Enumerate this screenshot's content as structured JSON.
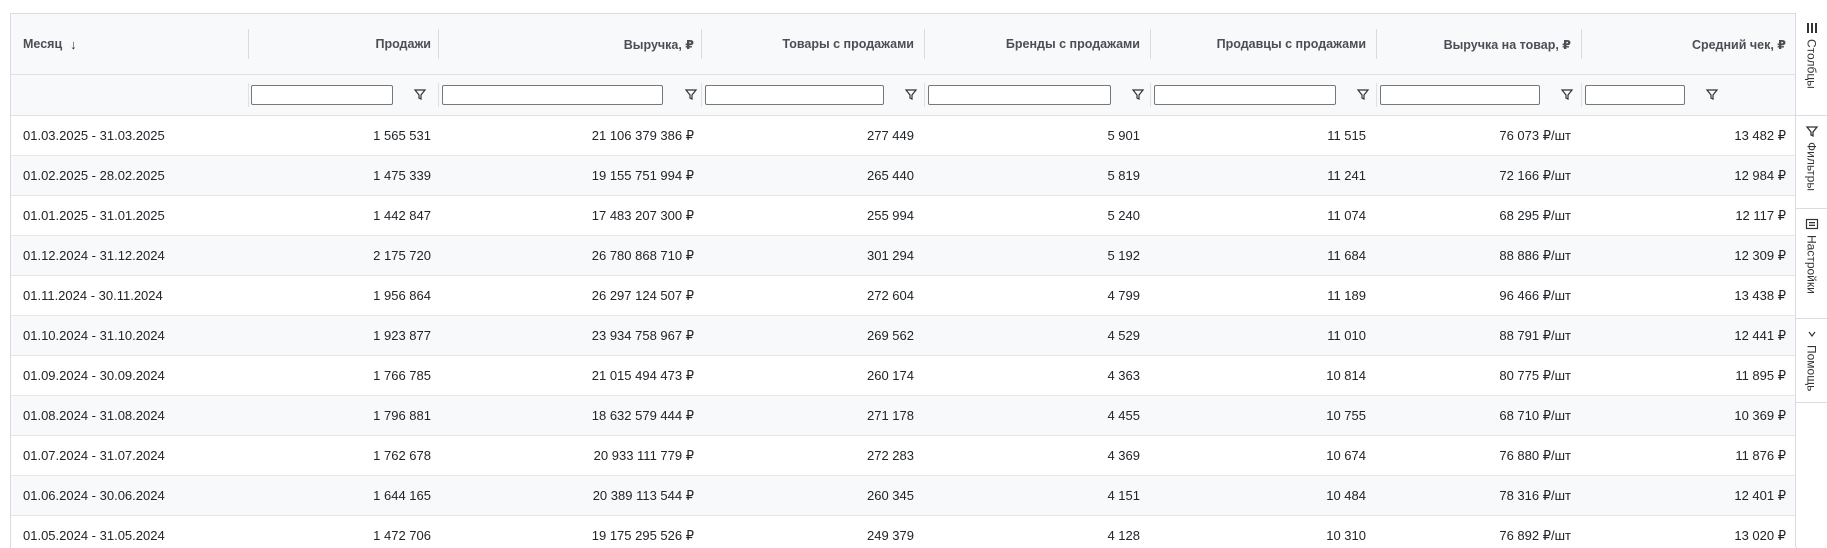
{
  "columns": [
    {
      "key": "month",
      "label": "Месяц",
      "sorted": "desc",
      "align": "left"
    },
    {
      "key": "sales",
      "label": "Продажи",
      "align": "right"
    },
    {
      "key": "revenue",
      "label": "Выручка, ₽",
      "align": "right"
    },
    {
      "key": "products",
      "label": "Товары с продажами",
      "align": "right"
    },
    {
      "key": "brands",
      "label": "Бренды с продажами",
      "align": "right"
    },
    {
      "key": "sellers",
      "label": "Продавцы с продажами",
      "align": "right"
    },
    {
      "key": "rev_per_item",
      "label": "Выручка на товар, ₽",
      "align": "right"
    },
    {
      "key": "avg_check",
      "label": "Средний чек, ₽",
      "align": "right"
    }
  ],
  "sort_icon": "arrow-down-icon",
  "filter_icon": "funnel-icon",
  "filters": {
    "sales": "",
    "revenue": "",
    "products": "",
    "brands": "",
    "sellers": "",
    "rev_per_item": "",
    "avg_check": ""
  },
  "rows": [
    [
      "01.03.2025 - 31.03.2025",
      "1 565 531",
      "21 106 379 386 ₽",
      "277 449",
      "5 901",
      "11 515",
      "76 073 ₽/шт",
      "13 482 ₽"
    ],
    [
      "01.02.2025 - 28.02.2025",
      "1 475 339",
      "19 155 751 994 ₽",
      "265 440",
      "5 819",
      "11 241",
      "72 166 ₽/шт",
      "12 984 ₽"
    ],
    [
      "01.01.2025 - 31.01.2025",
      "1 442 847",
      "17 483 207 300 ₽",
      "255 994",
      "5 240",
      "11 074",
      "68 295 ₽/шт",
      "12 117 ₽"
    ],
    [
      "01.12.2024 - 31.12.2024",
      "2 175 720",
      "26 780 868 710 ₽",
      "301 294",
      "5 192",
      "11 684",
      "88 886 ₽/шт",
      "12 309 ₽"
    ],
    [
      "01.11.2024 - 30.11.2024",
      "1 956 864",
      "26 297 124 507 ₽",
      "272 604",
      "4 799",
      "11 189",
      "96 466 ₽/шт",
      "13 438 ₽"
    ],
    [
      "01.10.2024 - 31.10.2024",
      "1 923 877",
      "23 934 758 967 ₽",
      "269 562",
      "4 529",
      "11 010",
      "88 791 ₽/шт",
      "12 441 ₽"
    ],
    [
      "01.09.2024 - 30.09.2024",
      "1 766 785",
      "21 015 494 473 ₽",
      "260 174",
      "4 363",
      "10 814",
      "80 775 ₽/шт",
      "11 895 ₽"
    ],
    [
      "01.08.2024 - 31.08.2024",
      "1 796 881",
      "18 632 579 444 ₽",
      "271 178",
      "4 455",
      "10 755",
      "68 710 ₽/шт",
      "10 369 ₽"
    ],
    [
      "01.07.2024 - 31.07.2024",
      "1 762 678",
      "20 933 111 779 ₽",
      "272 283",
      "4 369",
      "10 674",
      "76 880 ₽/шт",
      "11 876 ₽"
    ],
    [
      "01.06.2024 - 30.06.2024",
      "1 644 165",
      "20 389 113 544 ₽",
      "260 345",
      "4 151",
      "10 484",
      "78 316 ₽/шт",
      "12 401 ₽"
    ],
    [
      "01.05.2024 - 31.05.2024",
      "1 472 706",
      "19 175 295 526 ₽",
      "249 379",
      "4 128",
      "10 310",
      "76 892 ₽/шт",
      "13 020 ₽"
    ]
  ],
  "side_panel": [
    {
      "key": "columns",
      "label": "Столбцы",
      "icon": "columns-icon"
    },
    {
      "key": "filters",
      "label": "Фильтры",
      "icon": "filter-icon"
    },
    {
      "key": "settings",
      "label": "Настройки",
      "icon": "settings-icon"
    },
    {
      "key": "help",
      "label": "Помощь",
      "icon": "help-icon"
    }
  ],
  "colors": {
    "header_bg": "#f8f9fa",
    "row_alt_bg": "#f8f9fb",
    "border": "#d9dde3"
  }
}
